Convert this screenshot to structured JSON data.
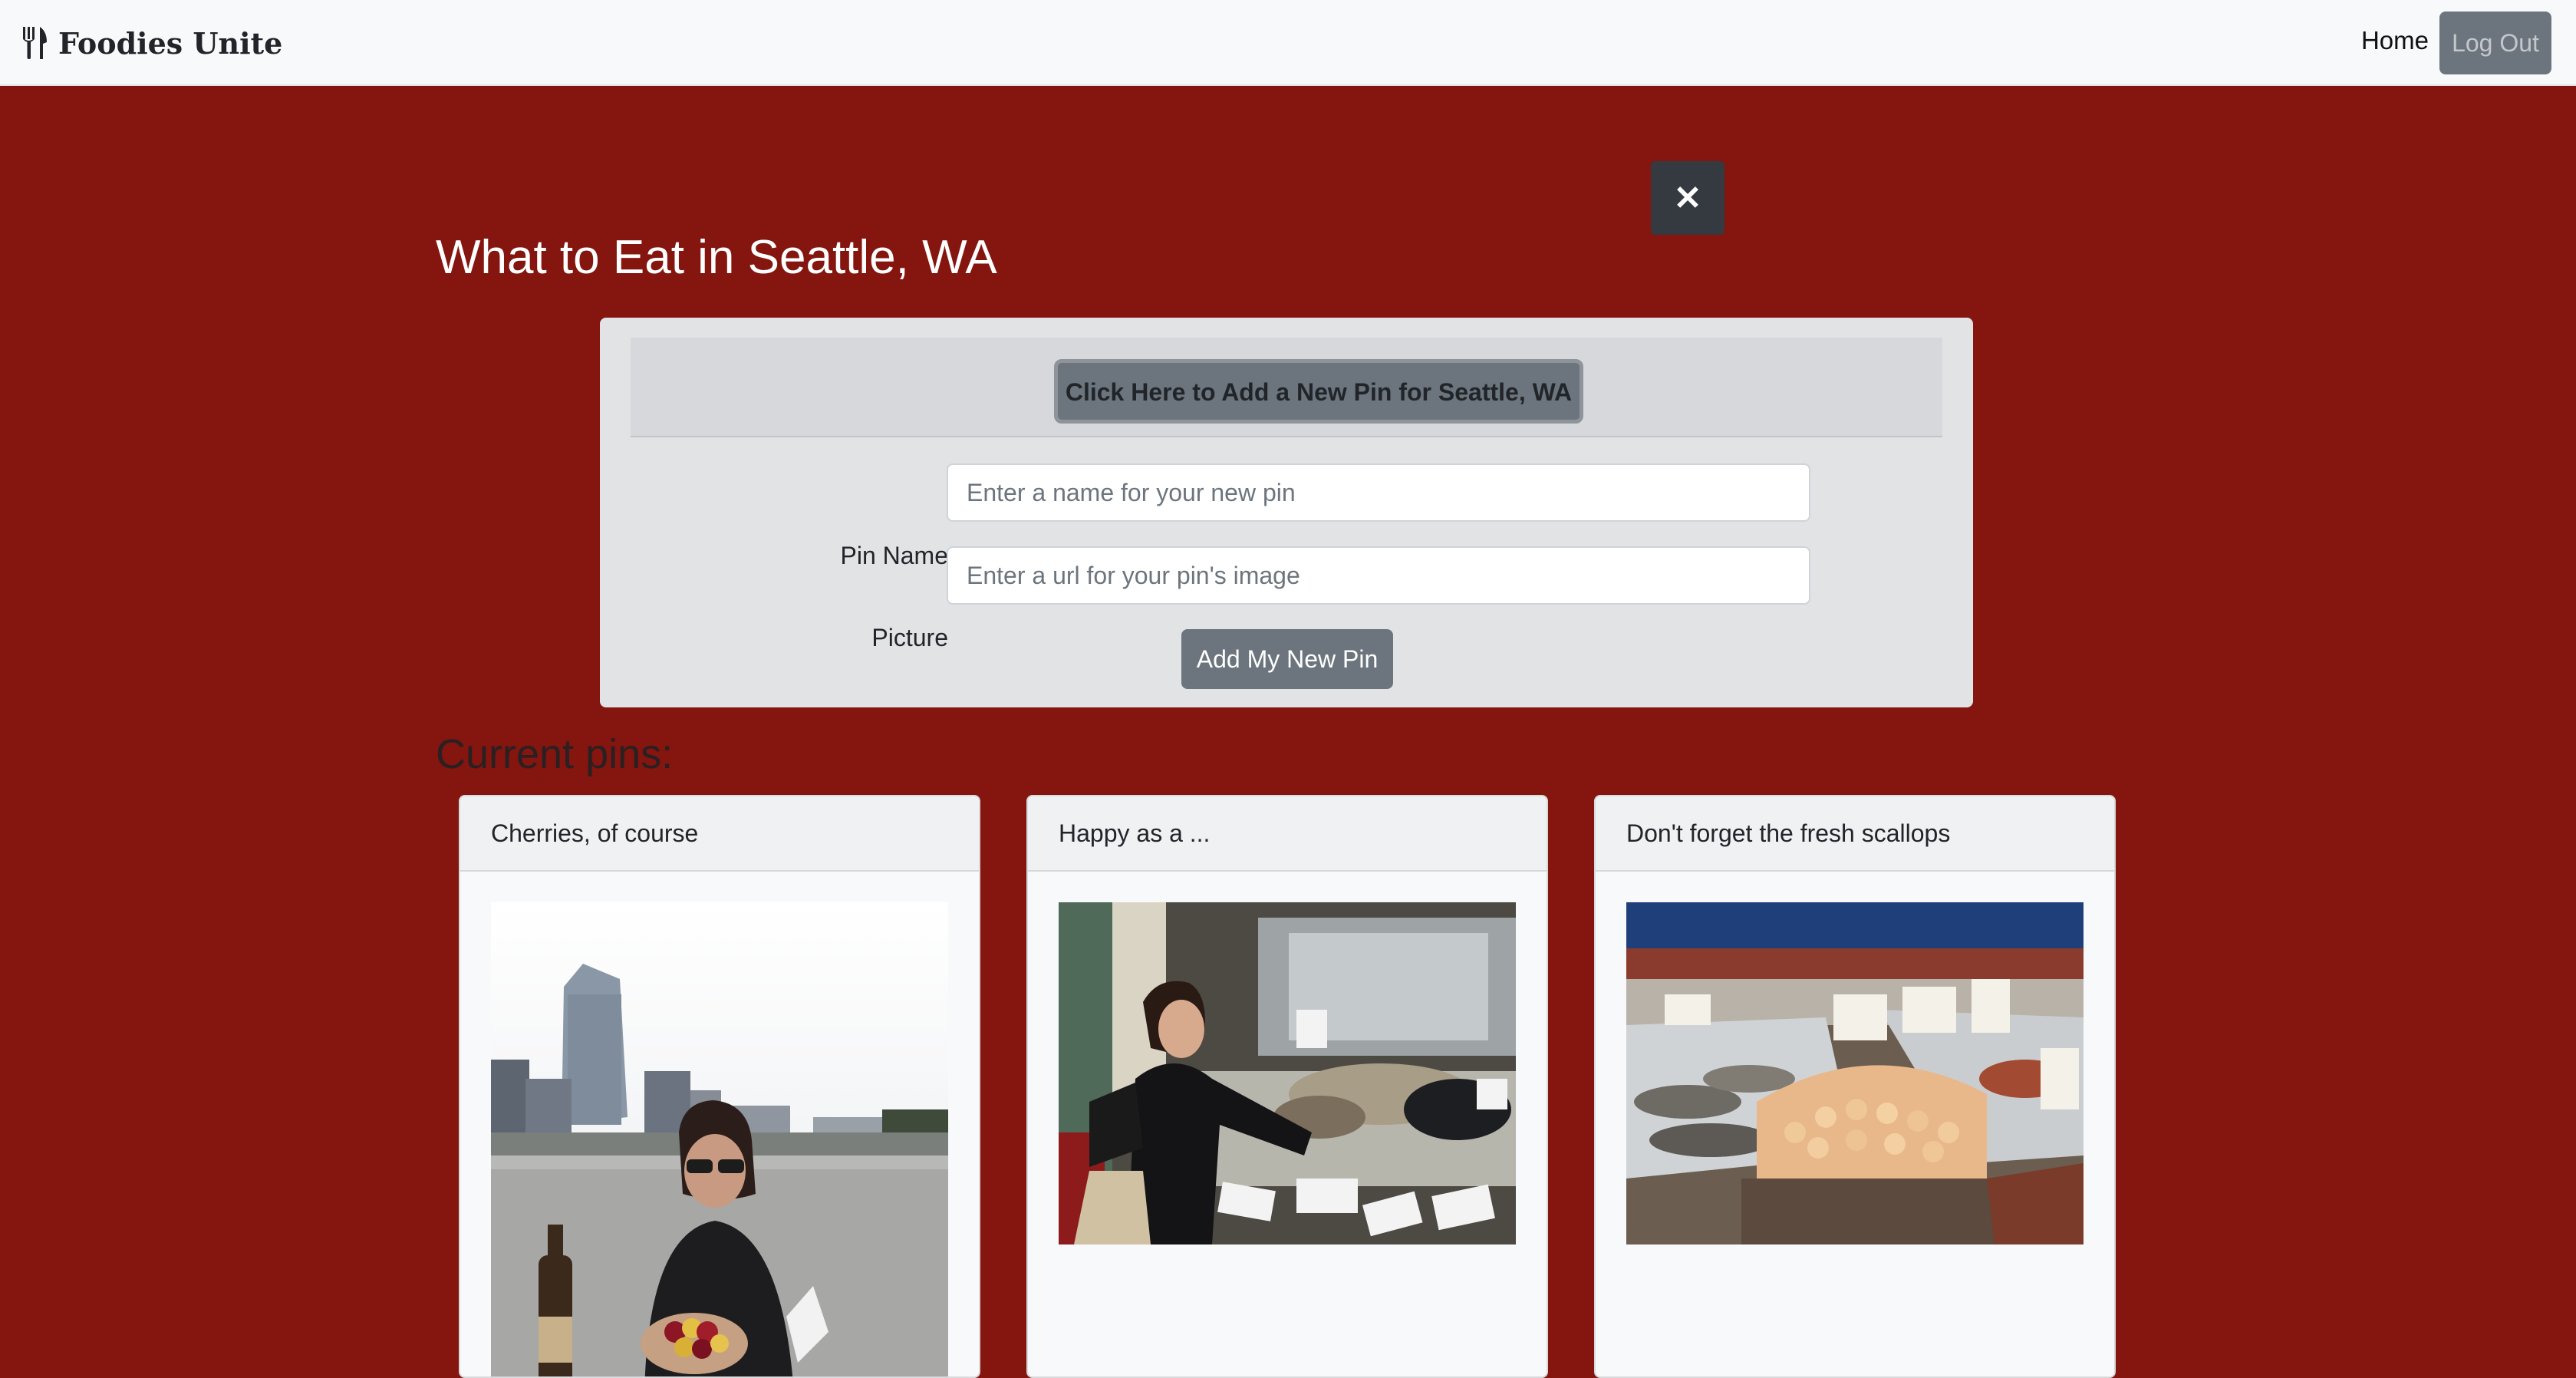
{
  "navbar": {
    "brand": "Foodies Unite",
    "brand_icon": "fork-knife-icon",
    "home_label": "Home",
    "logout_label": "Log Out"
  },
  "close_button": {
    "icon": "close-icon",
    "glyph": "✕"
  },
  "page": {
    "title": "What to Eat in Seattle, WA"
  },
  "form": {
    "toggle_label": "Click Here to Add a New Pin for Seattle, WA",
    "pin_name_label": "Pin Name",
    "pin_name_placeholder": "Enter a name for your new pin",
    "picture_label": "Picture",
    "picture_placeholder": "Enter a url for your pin's image",
    "submit_label": "Add My New Pin"
  },
  "pins": {
    "heading": "Current pins:",
    "items": [
      {
        "title": "Cherries, of course"
      },
      {
        "title": "Happy as a ..."
      },
      {
        "title": "Don't forget the fresh scallops"
      }
    ]
  },
  "colors": {
    "background": "#84150f",
    "navbar": "#f8f9fa",
    "secondary_button": "#6c757d",
    "dark_button": "#343a40",
    "form_card": "#e2e3e5"
  }
}
